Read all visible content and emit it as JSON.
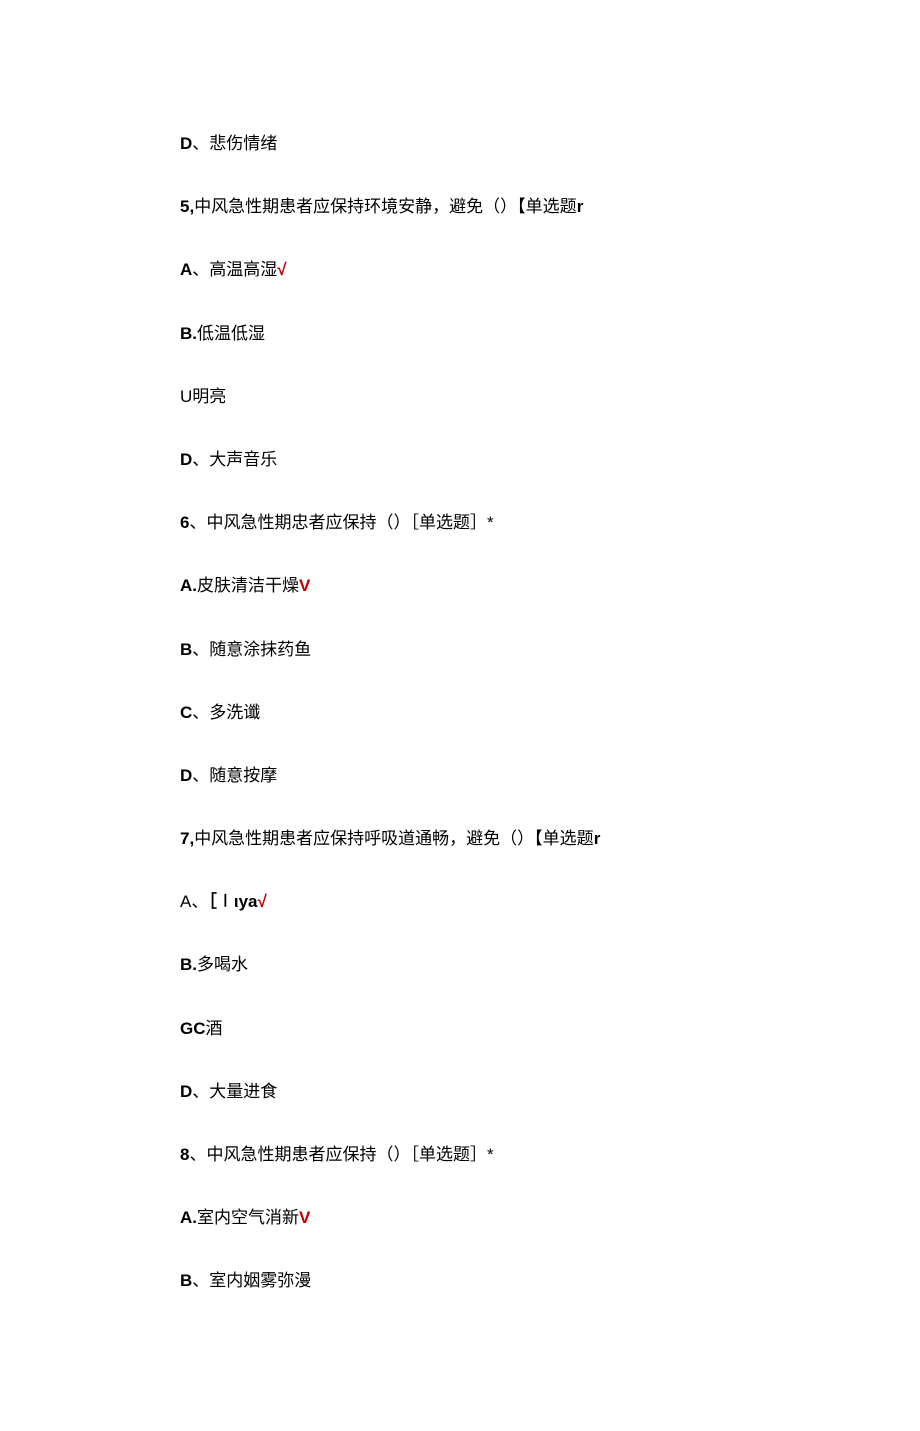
{
  "lines": [
    {
      "prefix": "D",
      "prefixBold": true,
      "sep": "、",
      "text": "悲伤情绪",
      "check": ""
    },
    {
      "prefix": "5,",
      "prefixBold": true,
      "sep": "",
      "text": "中风急性期患者应保持环境安静，避免（）【单选题",
      "suffix": "r",
      "suffixBold": true,
      "check": ""
    },
    {
      "prefix": "A",
      "prefixBold": true,
      "sep": "、",
      "text": "高温高湿",
      "check": "√"
    },
    {
      "prefix": "B.",
      "prefixBold": true,
      "sep": "",
      "text": "低温低湿",
      "check": ""
    },
    {
      "prefix": "U",
      "prefixBold": false,
      "sep": "",
      "text": "明亮",
      "check": ""
    },
    {
      "prefix": "D",
      "prefixBold": true,
      "sep": "、",
      "text": "大声音乐",
      "check": ""
    },
    {
      "prefix": "6",
      "prefixBold": true,
      "sep": "、",
      "text": "中风急性期忠者应保持（）［单选题］*",
      "check": ""
    },
    {
      "prefix": "A.",
      "prefixBold": true,
      "sep": "",
      "text": "皮肤清洁干燥",
      "check": "V"
    },
    {
      "prefix": "B",
      "prefixBold": true,
      "sep": "、",
      "text": "随意涂抹药鱼",
      "check": ""
    },
    {
      "prefix": "C",
      "prefixBold": true,
      "sep": "、",
      "text": "多洗谶",
      "check": ""
    },
    {
      "prefix": "D",
      "prefixBold": true,
      "sep": "、",
      "text": "随意按摩",
      "check": ""
    },
    {
      "prefix": "7,",
      "prefixBold": true,
      "sep": "",
      "text": "中风急性期患者应保持呼吸道通畅，避免（）【单选题",
      "suffix": "r",
      "suffixBold": true,
      "check": ""
    },
    {
      "prefix": "A",
      "prefixBold": false,
      "sep": "、",
      "text": "［∣ιya",
      "textBold": true,
      "check": "√"
    },
    {
      "prefix": "B.",
      "prefixBold": true,
      "sep": "",
      "text": "多喝水",
      "check": ""
    },
    {
      "prefix": "GC",
      "prefixBold": true,
      "sep": "",
      "text": "酒",
      "check": ""
    },
    {
      "prefix": "D",
      "prefixBold": true,
      "sep": "、",
      "text": "大量进食",
      "check": ""
    },
    {
      "prefix": "8",
      "prefixBold": true,
      "sep": "、",
      "text": "中风急性期患者应保持（）［单选题］*",
      "check": ""
    },
    {
      "prefix": "A.",
      "prefixBold": true,
      "sep": "",
      "text": "室内空气消新",
      "check": "V"
    },
    {
      "prefix": "B",
      "prefixBold": true,
      "sep": "、",
      "text": "室内姻雾弥漫",
      "check": ""
    }
  ]
}
